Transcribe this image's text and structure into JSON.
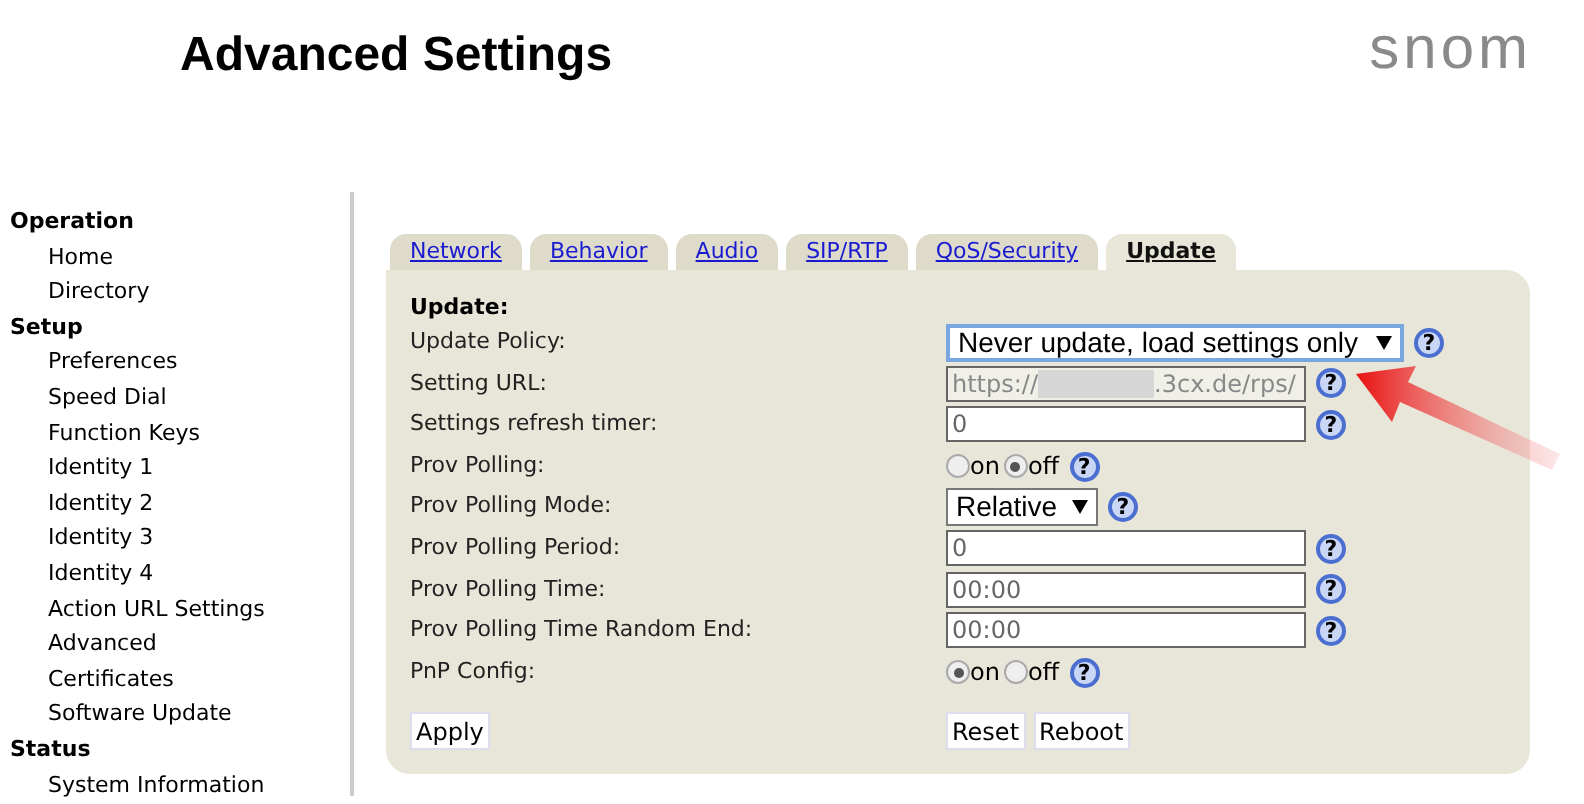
{
  "header": {
    "title": "Advanced Settings",
    "logo": "snom"
  },
  "sidebar": [
    {
      "heading": "Operation",
      "items": [
        "Home",
        "Directory"
      ]
    },
    {
      "heading": "Setup",
      "items": [
        "Preferences",
        "Speed Dial",
        "Function Keys",
        "Identity 1",
        "Identity 2",
        "Identity 3",
        "Identity 4",
        "Action URL Settings",
        "Advanced",
        "Certificates",
        "Software Update"
      ]
    },
    {
      "heading": "Status",
      "items": [
        "System Information"
      ]
    }
  ],
  "tabs": [
    {
      "label": "Network",
      "selected": false
    },
    {
      "label": "Behavior",
      "selected": false
    },
    {
      "label": "Audio",
      "selected": false
    },
    {
      "label": "SIP/RTP",
      "selected": false
    },
    {
      "label": "QoS/Security",
      "selected": false
    },
    {
      "label": "Update",
      "selected": true
    }
  ],
  "section_title": "Update:",
  "rows": [
    {
      "label": "Update Policy:",
      "kind": "select",
      "value": "Never update, load settings only",
      "wide": true,
      "help": "?"
    },
    {
      "label": "Setting URL:",
      "kind": "text",
      "value_prefix": "https://",
      "redacted": true,
      "value": ".3cx.de/rps/",
      "disabled": true,
      "help": "?",
      "annotated": true
    },
    {
      "label": "Settings refresh timer:",
      "kind": "text",
      "value": "0",
      "disabled": false,
      "help": "?"
    },
    {
      "label": "Prov Polling:",
      "kind": "radio",
      "options": [
        {
          "label": "on",
          "selected": false
        },
        {
          "label": "off",
          "selected": true
        }
      ],
      "help": "?"
    },
    {
      "label": "Prov Polling Mode:",
      "kind": "select",
      "value": "Relative",
      "wide": false,
      "help": "?"
    },
    {
      "label": "Prov Polling Period:",
      "kind": "text",
      "value": "0",
      "disabled": false,
      "help": "?"
    },
    {
      "label": "Prov Polling Time:",
      "kind": "text",
      "value": "00:00",
      "disabled": false,
      "help": "?"
    },
    {
      "label": "Prov Polling Time Random End:",
      "kind": "text",
      "value": "00:00",
      "disabled": false,
      "help": "?"
    },
    {
      "label": "PnP Config:",
      "kind": "radio",
      "options": [
        {
          "label": "on",
          "selected": true
        },
        {
          "label": "off",
          "selected": false
        }
      ],
      "help": "?"
    }
  ],
  "buttons": {
    "left": [
      "Apply"
    ],
    "right": [
      "Reset",
      "Reboot"
    ]
  }
}
